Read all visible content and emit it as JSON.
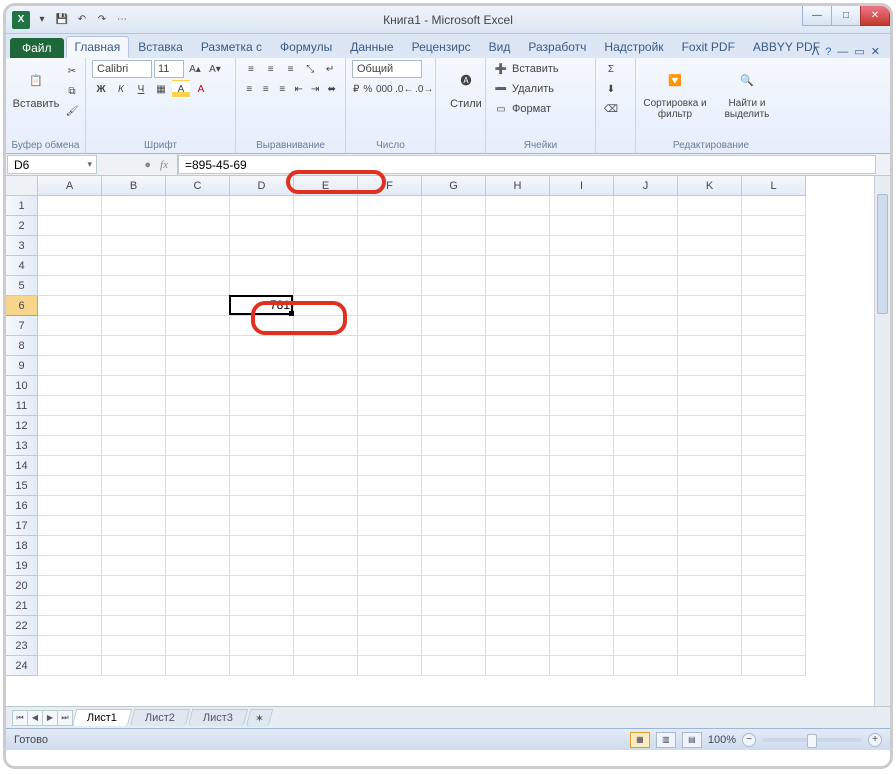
{
  "window": {
    "title": "Книга1 - Microsoft Excel"
  },
  "qat": {
    "save": "💾",
    "undo": "↶",
    "redo": "↷"
  },
  "tabs": {
    "file": "Файл",
    "items": [
      "Главная",
      "Вставка",
      "Разметка с",
      "Формулы",
      "Данные",
      "Рецензирс",
      "Вид",
      "Разработч",
      "Надстройк",
      "Foxit PDF",
      "ABBYY PDF"
    ],
    "active_index": 0
  },
  "ribbon": {
    "clipboard": {
      "paste": "Вставить",
      "label": "Буфер обмена"
    },
    "font": {
      "name": "Calibri",
      "size": "11",
      "bold": "Ж",
      "italic": "К",
      "underline": "Ч",
      "label": "Шрифт"
    },
    "align": {
      "label": "Выравнивание"
    },
    "number": {
      "format": "Общий",
      "label": "Число"
    },
    "styles": {
      "btn": "Стили"
    },
    "cells": {
      "insert": "Вставить",
      "delete": "Удалить",
      "format": "Формат",
      "label": "Ячейки"
    },
    "editing": {
      "sort": "Сортировка и фильтр",
      "find": "Найти и выделить",
      "label": "Редактирование"
    }
  },
  "fx": {
    "namebox": "D6",
    "formula": "=895-45-69"
  },
  "grid": {
    "columns": [
      "A",
      "B",
      "C",
      "D",
      "E",
      "F",
      "G",
      "H",
      "I",
      "J",
      "K",
      "L"
    ],
    "visible_rows": 24,
    "selected_row": 6,
    "selected_col_index": 3,
    "cells": {
      "D6": "781"
    }
  },
  "sheets": {
    "tabs": [
      "Лист1",
      "Лист2",
      "Лист3"
    ],
    "active": 0
  },
  "status": {
    "ready": "Готово",
    "zoom": "100%"
  }
}
